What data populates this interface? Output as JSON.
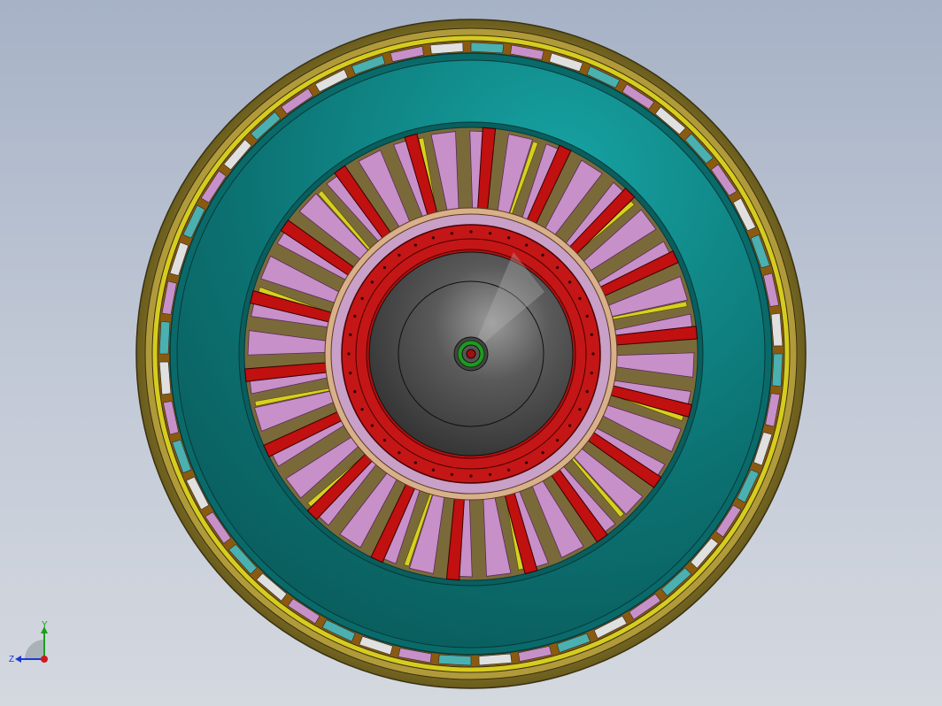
{
  "view": {
    "triad": {
      "y_label": "Y",
      "z_label": "Z"
    }
  },
  "colors": {
    "background_top": "#a6b2c6",
    "background_bottom": "#d4d8df",
    "outer_rim": "#8a7a2e",
    "outer_rim_inner": "#6b5a1a",
    "teal_ring": "#0f7f7f",
    "teal_ring_light": "#14a0a0",
    "vane_pink": "#c890c8",
    "vane_yellow": "#d8d020",
    "spoke_red": "#c01010",
    "hub_red": "#c81818",
    "cone_dark": "#3c3c3c",
    "cone_light": "#8a8a8a",
    "shaft_green": "#20a020"
  },
  "assembly": {
    "spoke_count": 18,
    "vane_count": 36,
    "outer_segment_count": 48
  }
}
